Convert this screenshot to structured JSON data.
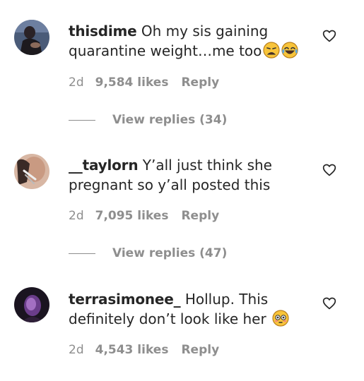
{
  "comments": [
    {
      "username": "thisdime",
      "text": " Oh my sis gaining quarantine weight…me too",
      "emojis": [
        "weary-face-emoji",
        "tears-of-joy-emoji"
      ],
      "age": "2d",
      "likes": "9,584 likes",
      "reply_label": "Reply",
      "view_replies": "View replies (34)"
    },
    {
      "username": "__taylorn",
      "text": " Y’all just think she pregnant so y’all posted this",
      "emojis": [],
      "age": "2d",
      "likes": "7,095 likes",
      "reply_label": "Reply",
      "view_replies": "View replies (47)"
    },
    {
      "username": "terrasimonee_",
      "text": " Hollup. This definitely don’t look like her",
      "emojis": [
        "flushed-face-emoji"
      ],
      "age": "2d",
      "likes": "4,543 likes",
      "reply_label": "Reply"
    }
  ],
  "colors": {
    "text": "#262626",
    "muted": "#8e8e8e",
    "background": "#ffffff"
  }
}
